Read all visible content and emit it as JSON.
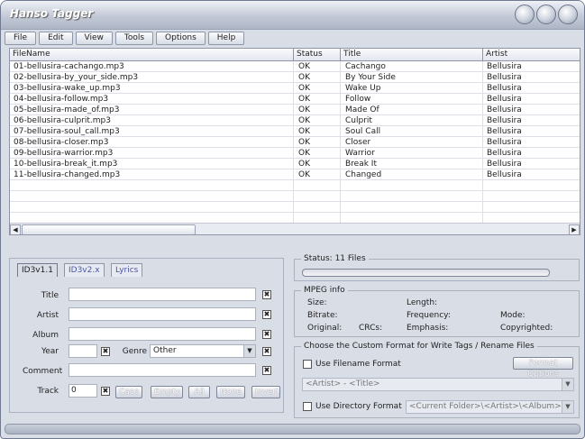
{
  "app": {
    "title": "Hanso Tagger"
  },
  "menu": [
    "File",
    "Edit",
    "View",
    "Tools",
    "Options",
    "Help"
  ],
  "list": {
    "columns": [
      "FileName",
      "Status",
      "Title",
      "Artist"
    ],
    "rows": [
      [
        "01-bellusira-cachango.mp3",
        "OK",
        "Cachango",
        "Bellusira"
      ],
      [
        "02-bellusira-by_your_side.mp3",
        "OK",
        "By Your Side",
        "Bellusira"
      ],
      [
        "03-bellusira-wake_up.mp3",
        "OK",
        "Wake Up",
        "Bellusira"
      ],
      [
        "04-bellusira-follow.mp3",
        "OK",
        "Follow",
        "Bellusira"
      ],
      [
        "05-bellusira-made_of.mp3",
        "OK",
        "Made Of",
        "Bellusira"
      ],
      [
        "06-bellusira-culprit.mp3",
        "OK",
        "Culprit",
        "Bellusira"
      ],
      [
        "07-bellusira-soul_call.mp3",
        "OK",
        "Soul Call",
        "Bellusira"
      ],
      [
        "08-bellusira-closer.mp3",
        "OK",
        "Closer",
        "Bellusira"
      ],
      [
        "09-bellusira-warrior.mp3",
        "OK",
        "Warrior",
        "Bellusira"
      ],
      [
        "10-bellusira-break_it.mp3",
        "OK",
        "Break It",
        "Bellusira"
      ],
      [
        "11-bellusira-changed.mp3",
        "OK",
        "Changed",
        "Bellusira"
      ]
    ]
  },
  "tabs": [
    "ID3v1.1",
    "ID3v2.x",
    "Lyrics"
  ],
  "tagform": {
    "title_label": "Title",
    "artist_label": "Artist",
    "album_label": "Album",
    "year_label": "Year",
    "genre_label": "Genre",
    "genre_value": "Other",
    "comment_label": "Comment",
    "track_label": "Track",
    "track_value": "0",
    "buttons": [
      "Case",
      "Empty",
      "All",
      "None",
      "Invert"
    ]
  },
  "status": {
    "text": "Status: 11 Files",
    "progress": 0
  },
  "mpeg": {
    "title": "MPEG info",
    "size": "Size:",
    "length": "Length:",
    "bitrate": "Bitrate:",
    "frequency": "Frequency:",
    "mode": "Mode:",
    "original": "Original:",
    "crcs": "CRCs:",
    "emphasis": "Emphasis:",
    "copyrighted": "Copyrighted:"
  },
  "format": {
    "title": "Choose the Custom Format for Write Tags / Rename Files",
    "use_filename": "Use Filename Format",
    "format_options": "Format Options",
    "filename_pattern": "<Artist> - <Title>",
    "use_directory": "Use Directory Format",
    "directory_pattern": "<Current Folder>\\<Artist>\\<Album>\\"
  },
  "icons": {
    "close_x": "✖",
    "dropdown": "▼",
    "left": "◀",
    "right": "▶"
  }
}
